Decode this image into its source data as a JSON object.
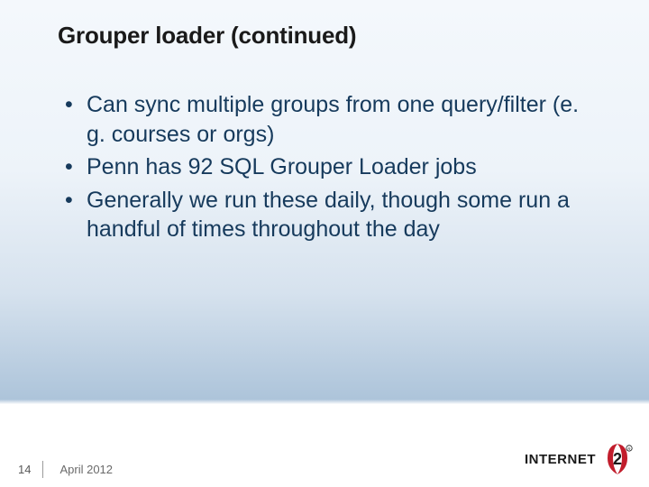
{
  "title": "Grouper loader (continued)",
  "bullets": [
    "Can sync multiple groups from one query/filter (e. g. courses or orgs)",
    "Penn has 92 SQL Grouper Loader jobs",
    "Generally we run these daily, though some run a handful of times throughout the day"
  ],
  "footer": {
    "page": "14",
    "date": "April 2012"
  },
  "logo_name": "INTERNET2"
}
